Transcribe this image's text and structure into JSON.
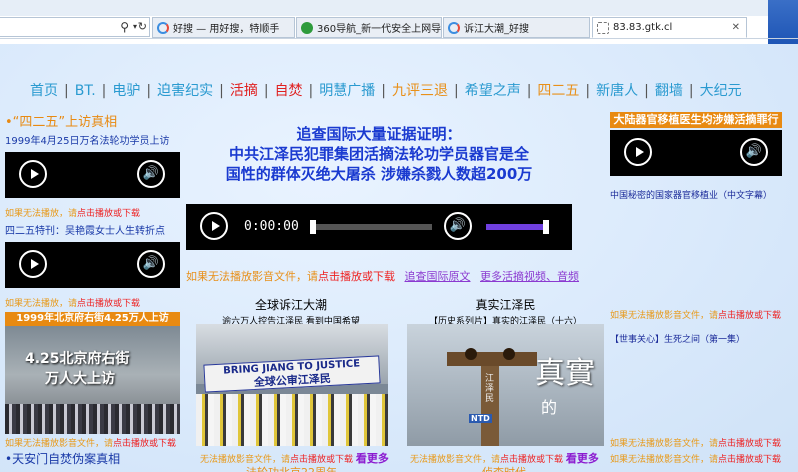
{
  "browser": {
    "address": "",
    "tabs": [
      {
        "title": "好搜 — 用好搜，特顺手",
        "active": false
      },
      {
        "title": "360导航_新一代安全上网导航",
        "active": false
      },
      {
        "title": "诉江大潮_好搜",
        "active": false
      },
      {
        "title": "83.83.gtk.cl",
        "active": true
      }
    ]
  },
  "nav": [
    {
      "label": "首页",
      "color": "#2a9ad0"
    },
    {
      "label": "BT.",
      "color": "#2a9ad0"
    },
    {
      "label": "电驴",
      "color": "#2a9ad0"
    },
    {
      "label": "迫害纪实",
      "color": "#2a9ad0"
    },
    {
      "label": "活摘",
      "color": "#e02020"
    },
    {
      "label": "自焚",
      "color": "#e02020"
    },
    {
      "label": "明慧广播",
      "color": "#2a9ad0"
    },
    {
      "label": "九评三退",
      "color": "#e8901a"
    },
    {
      "label": "希望之声",
      "color": "#2a9ad0"
    },
    {
      "label": "四二五",
      "color": "#e8901a"
    },
    {
      "label": "新唐人",
      "color": "#2a9ad0"
    },
    {
      "label": "翻墙",
      "color": "#2a9ad0"
    },
    {
      "label": "大纪元",
      "color": "#2a9ad0"
    }
  ],
  "left": {
    "section1": {
      "title": "•“四二五”上访真相",
      "subtitle": "1999年4月25日万名法轮功学员上访",
      "hint_prefix": "如果无法播放，请",
      "hint_link": "点击播放或下载"
    },
    "section2": {
      "subtitle": "四二五特刊：吴艳霞女士人生转折点",
      "hint_prefix": "如果无法播放，请",
      "hint_link": "点击播放或下载"
    },
    "section3": {
      "banner": "1999年北京府右街4.25万人上访",
      "overlay_line1": "4.25北京府右街",
      "overlay_line2": "万人大上访",
      "hint_prefix": "如果无法播放影音文件，请",
      "hint_link": "点击播放或下载"
    },
    "section4": {
      "title": "•天安门自焚伪案真相"
    }
  },
  "center": {
    "headline_line1": "追查国际大量证据证明：",
    "headline_line2": "中共江泽民犯罪集团活摘法轮功学员器官是全",
    "headline_line3": "国性的群体灭绝大屠杀 涉嫌杀戮人数超200万",
    "player_time": "0:00:00",
    "player_progress": 0,
    "player_volume": 1.0,
    "links_hint_prefix": "如果无法播放影音文件，请",
    "links_hint_link": "点击播放或下载",
    "link_original": "追查国际原文",
    "link_more": "更多活摘视频、音频",
    "video1": {
      "title": "全球诉江大潮",
      "subtitle": "逾六万人控告江泽民 看到中国希望",
      "banner_en": "BRING JIANG TO JUSTICE",
      "banner_cn": "全球公审江泽民",
      "caption_prefix": "无法播放影音文件，请",
      "caption_link": "点击播放或下载",
      "caption_more": "看更多",
      "footer": "法轮功北京22周年"
    },
    "video2": {
      "title": "真实江泽民",
      "subtitle": "【历史系列片】真实的江泽民（十六）",
      "overlay_big": "真實",
      "overlay_small": "的",
      "stock_label": "江泽民",
      "logo": "NTD",
      "caption_prefix": "无法播放影音文件，请",
      "caption_link": "点击播放或下载",
      "caption_more": "看更多",
      "footer": "侦查时代"
    }
  },
  "right": {
    "title": "大陆器官移植医生均涉嫌活摘罪行",
    "sub1": "中国秘密的国家器官移植业（中文字幕）",
    "hint1_prefix": "如果无法播放影音文件，请",
    "hint1_link": "点击播放或下载",
    "sub2": "【世事关心】生死之间（第一集）",
    "hint2_prefix": "如果无法播放影音文件，请",
    "hint2_link": "点击播放或下载",
    "hint3_prefix": "如果无法播放影音文件，请",
    "hint3_link": "点击播放或下载"
  },
  "colors": {
    "nav_blue": "#2a9ad0",
    "nav_red": "#e02020",
    "nav_orange": "#e8901a",
    "headline_blue": "#1a3ad0",
    "volume_purple": "#7040e0",
    "right_banner": "#e88a12"
  }
}
